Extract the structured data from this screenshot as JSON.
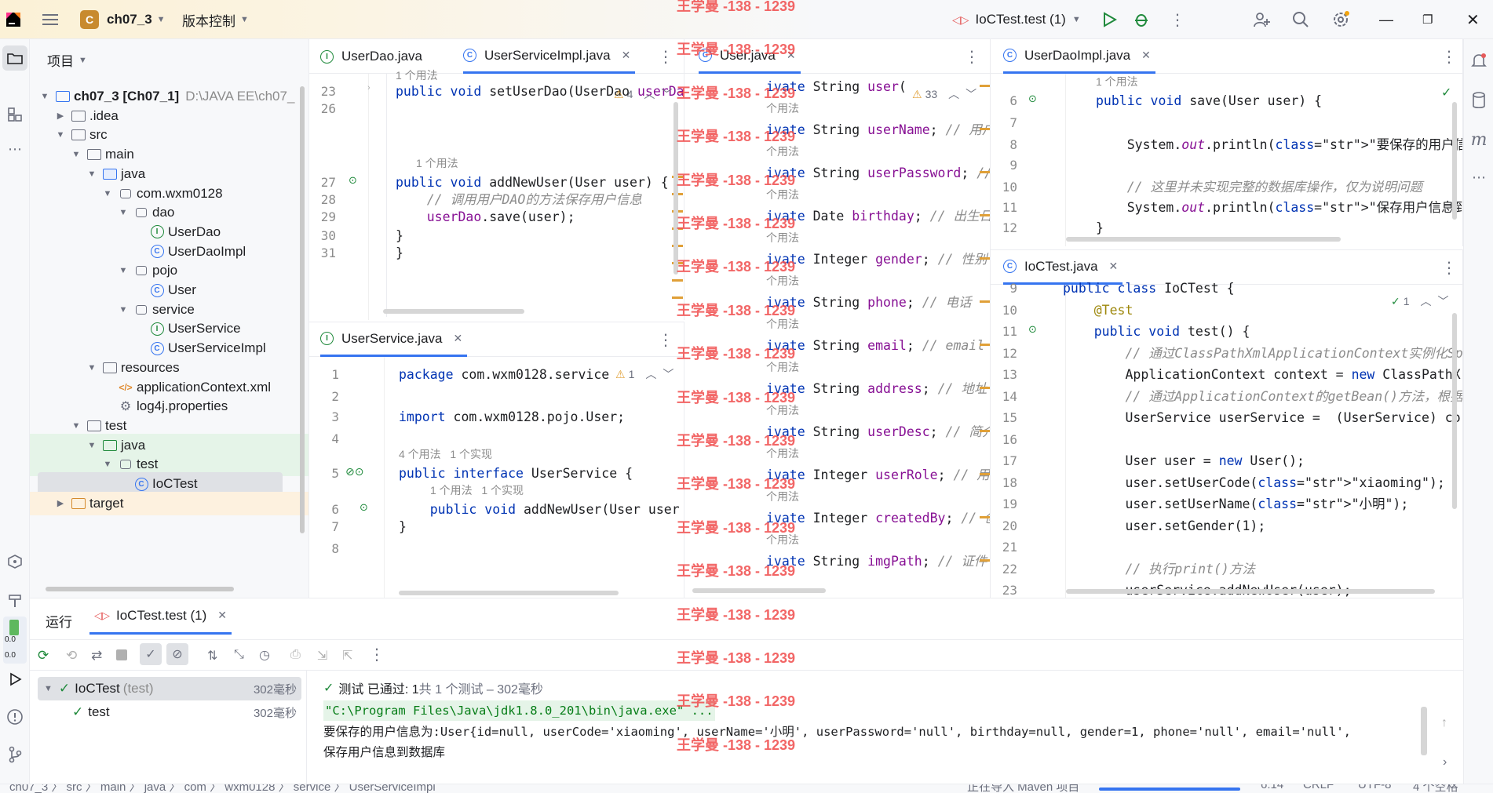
{
  "titlebar": {
    "project_badge": "C",
    "project_name": "ch07_3",
    "vcs_label": "版本控制",
    "run_config": "IoCTest.test (1)"
  },
  "project_panel": {
    "title": "项目",
    "tree": [
      {
        "label": "ch07_3 [Ch07_1]",
        "extra": "D:\\JAVA EE\\ch07_",
        "depth": 0,
        "type": "module",
        "arrow": "down"
      },
      {
        "label": ".idea",
        "depth": 1,
        "type": "folder",
        "arrow": "right"
      },
      {
        "label": "src",
        "depth": 1,
        "type": "folder",
        "arrow": "down"
      },
      {
        "label": "main",
        "depth": 2,
        "type": "folder",
        "arrow": "down"
      },
      {
        "label": "java",
        "depth": 3,
        "type": "folder-blue",
        "arrow": "down"
      },
      {
        "label": "com.wxm0128",
        "depth": 4,
        "type": "package",
        "arrow": "down"
      },
      {
        "label": "dao",
        "depth": 5,
        "type": "package",
        "arrow": "down"
      },
      {
        "label": "UserDao",
        "depth": 6,
        "type": "interface",
        "arrow": ""
      },
      {
        "label": "UserDaoImpl",
        "depth": 6,
        "type": "class",
        "arrow": ""
      },
      {
        "label": "pojo",
        "depth": 5,
        "type": "package",
        "arrow": "down"
      },
      {
        "label": "User",
        "depth": 6,
        "type": "class",
        "arrow": ""
      },
      {
        "label": "service",
        "depth": 5,
        "type": "package",
        "arrow": "down"
      },
      {
        "label": "UserService",
        "depth": 6,
        "type": "interface",
        "arrow": ""
      },
      {
        "label": "UserServiceImpl",
        "depth": 6,
        "type": "class",
        "arrow": ""
      },
      {
        "label": "resources",
        "depth": 3,
        "type": "folder",
        "arrow": "down"
      },
      {
        "label": "applicationContext.xml",
        "depth": 4,
        "type": "xml",
        "arrow": ""
      },
      {
        "label": "log4j.properties",
        "depth": 4,
        "type": "props",
        "arrow": ""
      },
      {
        "label": "test",
        "depth": 2,
        "type": "folder",
        "arrow": "down"
      },
      {
        "label": "java",
        "depth": 3,
        "type": "folder-green",
        "arrow": "down"
      },
      {
        "label": "test",
        "depth": 4,
        "type": "package",
        "arrow": "down"
      },
      {
        "label": "IoCTest",
        "depth": 5,
        "type": "class",
        "arrow": ""
      },
      {
        "label": "target",
        "depth": 1,
        "type": "folder-orange",
        "arrow": "right"
      }
    ]
  },
  "editor1": {
    "tabs": [
      "UserDao.java",
      "UserServiceImpl.java"
    ],
    "warn": "4",
    "usage_top": "1 个用法",
    "lines": [
      {
        "n": "23",
        "t": "public void setUserDao(UserDao userDao"
      },
      {
        "n": "26",
        "t": ""
      },
      {
        "n": "27",
        "t": "public void addNewUser(User user) {"
      },
      {
        "n": "28",
        "t": "    // 调用用户DAO的方法保存用户信息"
      },
      {
        "n": "29",
        "t": "    userDao.save(user);"
      },
      {
        "n": "30",
        "t": "}"
      },
      {
        "n": "31",
        "t": "}"
      }
    ],
    "usage_27": "1 个用法"
  },
  "editor2": {
    "tab": "User.java",
    "warn": "33",
    "usage": "个用法",
    "lines": [
      "ivate String user(",
      "ivate String userName; // 用户",
      "ivate String userPassword; //",
      "ivate Date birthday; // 出生日",
      "ivate Integer gender; // 性别",
      "ivate String phone; // 电话",
      "ivate String email; // email",
      "ivate String address; // 地址",
      "ivate String userDesc; // 简介",
      "ivate Integer userRole; // 用",
      "ivate Integer createdBy; // 创",
      "ivate String imgPath; // 证件"
    ]
  },
  "editor3": {
    "tab": "UserDaoImpl.java",
    "usage": "1 个用法",
    "lines": [
      {
        "n": "6",
        "t": "public void save(User user) {"
      },
      {
        "n": "7",
        "t": ""
      },
      {
        "n": "8",
        "t": "    System.out.println(\"要保存的用户信息为:\" + use"
      },
      {
        "n": "9",
        "t": ""
      },
      {
        "n": "10",
        "t": "    // 这里并未实现完整的数据库操作，仅为说明问题"
      },
      {
        "n": "11",
        "t": "    System.out.println(\"保存用户信息到数据库\");"
      },
      {
        "n": "12",
        "t": "}"
      }
    ]
  },
  "editor4": {
    "tab": "UserService.java",
    "warn": "1",
    "usage_5": "4 个用法   1 个实现",
    "usage_6": "1 个用法   1 个实现",
    "lines": [
      {
        "n": "1",
        "t": "package com.wxm0128.service"
      },
      {
        "n": "2",
        "t": ""
      },
      {
        "n": "3",
        "t": "import com.wxm0128.pojo.User;"
      },
      {
        "n": "4",
        "t": ""
      },
      {
        "n": "5",
        "t": "public interface UserService {"
      },
      {
        "n": "6",
        "t": "    public void addNewUser(User user"
      },
      {
        "n": "7",
        "t": "}"
      },
      {
        "n": "8",
        "t": ""
      }
    ]
  },
  "editor5": {
    "tab": "IoCTest.java",
    "check": "1",
    "lines": [
      {
        "n": "9",
        "t": "public class IoCTest {"
      },
      {
        "n": "10",
        "t": "    @Test"
      },
      {
        "n": "11",
        "t": "    public void test() {"
      },
      {
        "n": "12",
        "t": "        // 通过ClassPathXmlApplicationContext实例化Sp"
      },
      {
        "n": "13",
        "t": "        ApplicationContext context = new ClassPathX"
      },
      {
        "n": "14",
        "t": "        // 通过ApplicationContext的getBean()方法，根据"
      },
      {
        "n": "15",
        "t": "        UserService userService =  (UserService) co"
      },
      {
        "n": "16",
        "t": ""
      },
      {
        "n": "17",
        "t": "        User user = new User();"
      },
      {
        "n": "18",
        "t": "        user.setUserCode(\"xiaoming\");"
      },
      {
        "n": "19",
        "t": "        user.setUserName(\"小明\");"
      },
      {
        "n": "20",
        "t": "        user.setGender(1);"
      },
      {
        "n": "21",
        "t": ""
      },
      {
        "n": "22",
        "t": "        // 执行print()方法"
      },
      {
        "n": "23",
        "t": "        userService.addNewUser(user);"
      }
    ]
  },
  "run": {
    "label": "运行",
    "tab": "IoCTest.test (1)",
    "tree_root": "IoCTest",
    "tree_root_suffix": "(test)",
    "tree_root_time": "302毫秒",
    "tree_child": "test",
    "tree_child_time": "302毫秒",
    "status_prefix": "测试 已通过: 1",
    "status_suffix": "共 1 个测试 – 302毫秒",
    "console": [
      "\"C:\\Program Files\\Java\\jdk1.8.0_201\\bin\\java.exe\" ...",
      "要保存的用户信息为:User{id=null, userCode='xiaoming', userName='小明', userPassword='null', birthday=null, gender=1, phone='null', email='null',",
      "保存用户信息到数据库"
    ]
  },
  "statusbar": {
    "breadcrumb": "ch07_3 〉 src 〉 main 〉 java 〉 com 〉 wxm0128 〉 service 〉 UserServiceImpl",
    "import": "正在导入 Maven 项目",
    "position": "6:14",
    "line_sep": "CRLF",
    "encoding": "UTF-8",
    "indent": "4 个空格"
  },
  "left_mem": [
    "0.0",
    "0.0"
  ],
  "watermark": "王学曼 -138 - 1239",
  "colors": {
    "accent": "#3574f0",
    "success": "#208a3c",
    "keyword": "#0033b3",
    "string": "#067d17",
    "field": "#871094",
    "warning": "#e0a038",
    "watermark": "#f04c4c"
  }
}
